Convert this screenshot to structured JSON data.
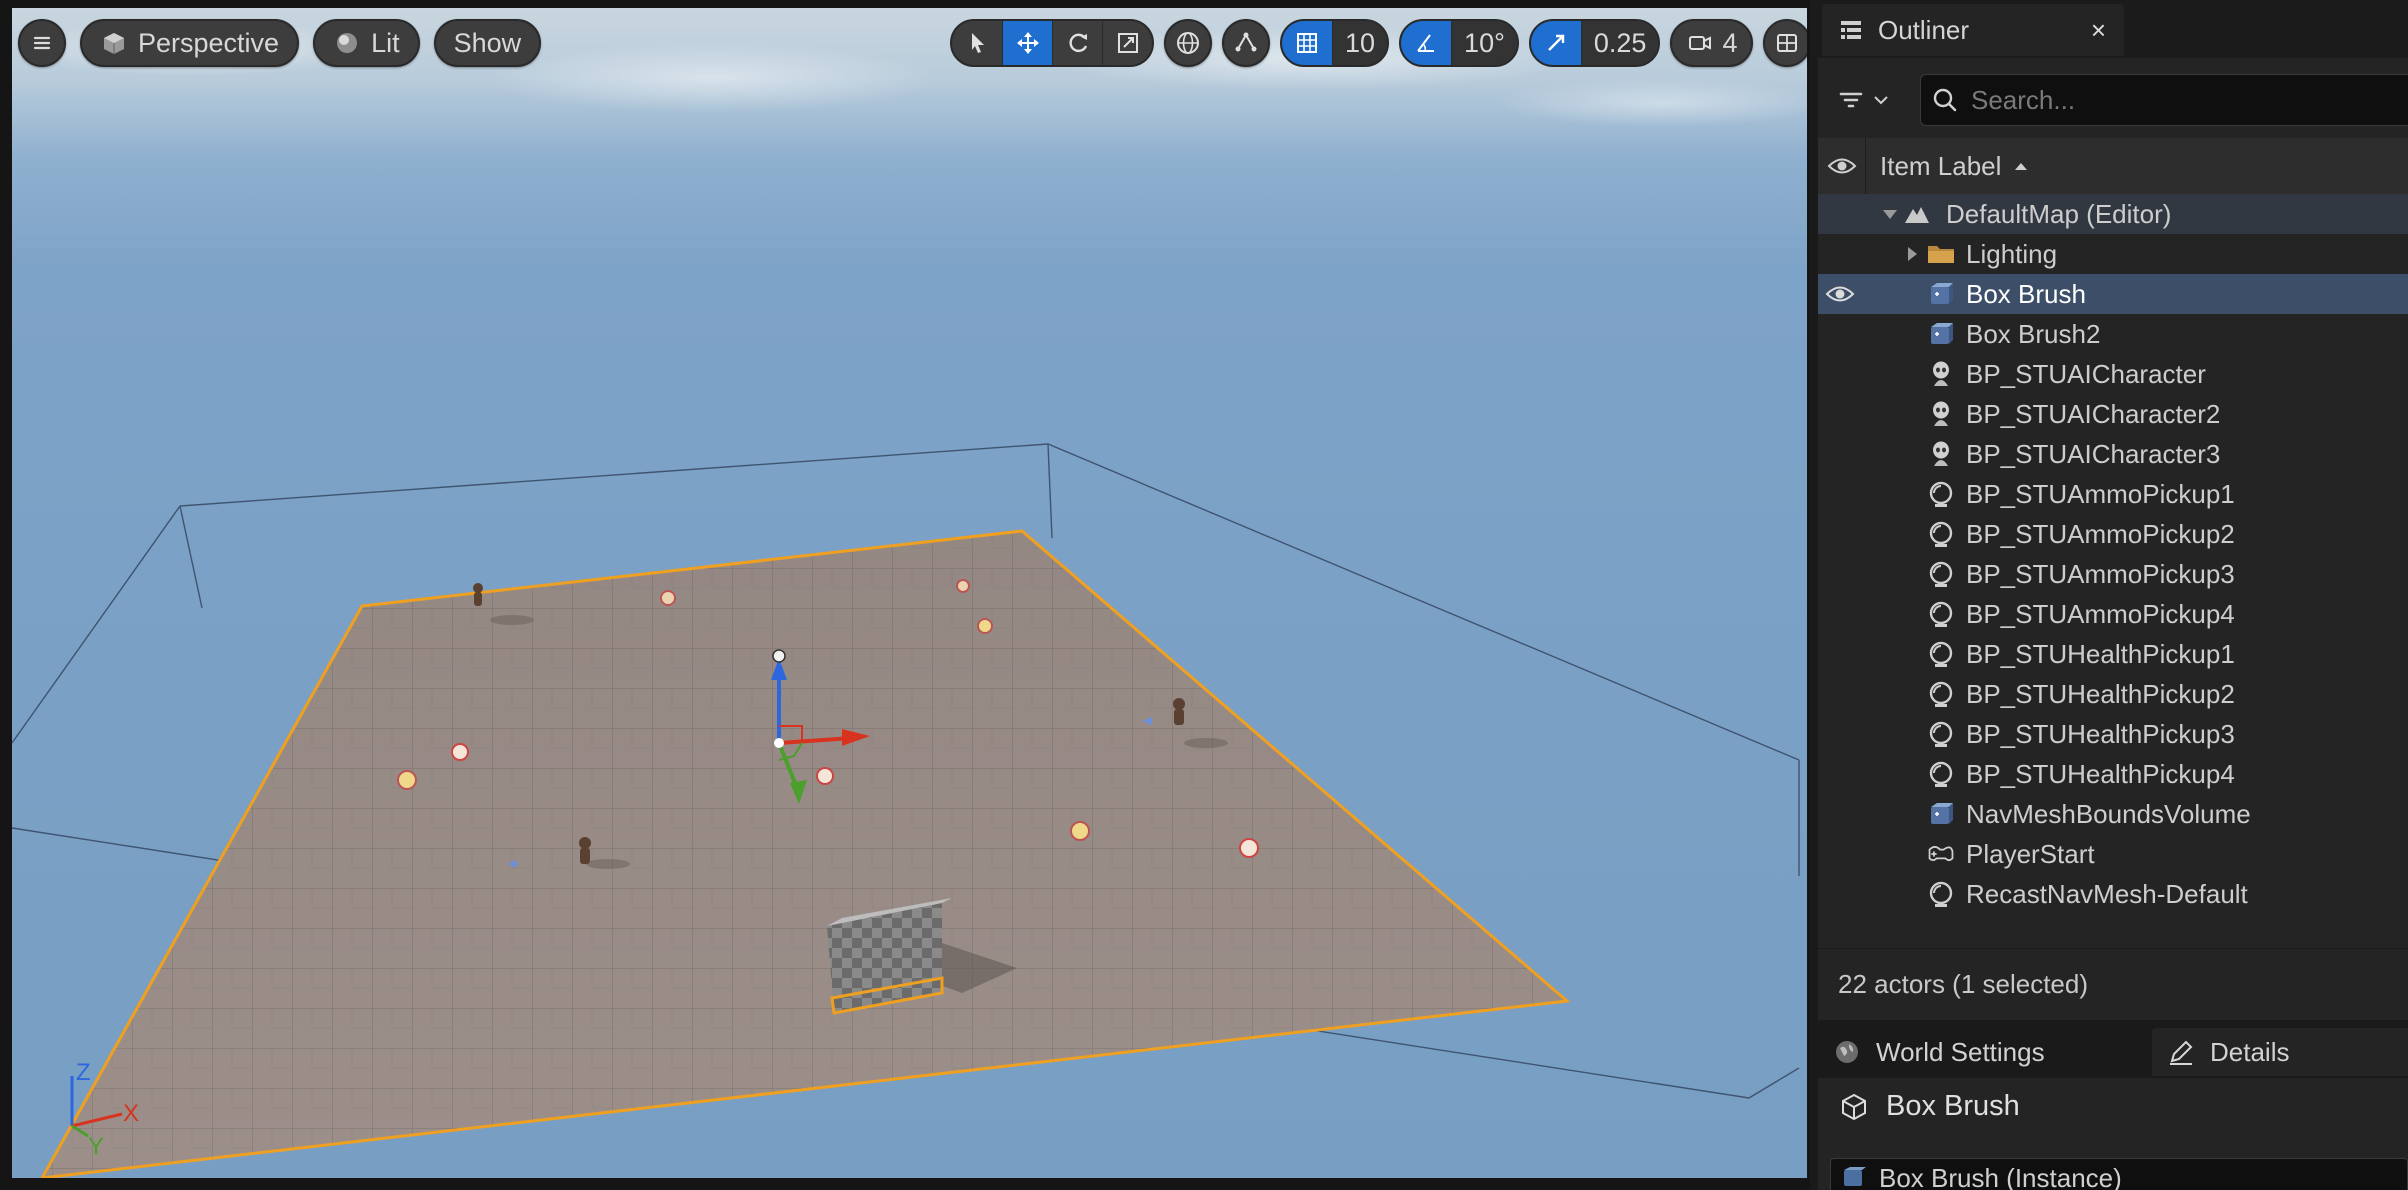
{
  "viewport": {
    "menu_icon": "hamburger-icon",
    "view_mode": "Perspective",
    "lighting_mode": "Lit",
    "show_label": "Show",
    "grid_snap_value": "10",
    "rotation_snap_value": "10°",
    "scale_snap_value": "0.25",
    "camera_speed_value": "4",
    "axis_labels": {
      "x": "X",
      "y": "Y",
      "z": "Z"
    },
    "colors": {
      "active_tool": "#1e6fcf",
      "selection_outline": "#f0a020",
      "floor": "#9a8d88"
    }
  },
  "outliner": {
    "tab_title": "Outliner",
    "close_symbol": "×",
    "search_placeholder": "Search...",
    "column_label": "Item Label",
    "items": [
      {
        "label": "DefaultMap (Editor)",
        "icon": "map-icon",
        "level": 0,
        "expanded": true,
        "root": true
      },
      {
        "label": "Lighting",
        "icon": "folder-icon",
        "level": 1,
        "expandable": true
      },
      {
        "label": "Box Brush",
        "icon": "brush-icon",
        "level": 1,
        "selected": true
      },
      {
        "label": "Box Brush2",
        "icon": "brush-icon",
        "level": 1
      },
      {
        "label": "BP_STUAICharacter",
        "icon": "character-icon",
        "level": 1
      },
      {
        "label": "BP_STUAICharacter2",
        "icon": "character-icon",
        "level": 1
      },
      {
        "label": "BP_STUAICharacter3",
        "icon": "character-icon",
        "level": 1
      },
      {
        "label": "BP_STUAmmoPickup1",
        "icon": "actor-icon",
        "level": 1
      },
      {
        "label": "BP_STUAmmoPickup2",
        "icon": "actor-icon",
        "level": 1
      },
      {
        "label": "BP_STUAmmoPickup3",
        "icon": "actor-icon",
        "level": 1
      },
      {
        "label": "BP_STUAmmoPickup4",
        "icon": "actor-icon",
        "level": 1
      },
      {
        "label": "BP_STUHealthPickup1",
        "icon": "actor-icon",
        "level": 1
      },
      {
        "label": "BP_STUHealthPickup2",
        "icon": "actor-icon",
        "level": 1
      },
      {
        "label": "BP_STUHealthPickup3",
        "icon": "actor-icon",
        "level": 1
      },
      {
        "label": "BP_STUHealthPickup4",
        "icon": "actor-icon",
        "level": 1
      },
      {
        "label": "NavMeshBoundsVolume",
        "icon": "brush-icon",
        "level": 1
      },
      {
        "label": "PlayerStart",
        "icon": "player-start-icon",
        "level": 1
      },
      {
        "label": "RecastNavMesh-Default",
        "icon": "actor-icon",
        "level": 1
      }
    ],
    "status": "22 actors (1 selected)"
  },
  "lower_panel": {
    "tab_world_settings": "World Settings",
    "tab_details": "Details",
    "selected_name": "Box Brush",
    "instance_label": "Box Brush (Instance)"
  }
}
